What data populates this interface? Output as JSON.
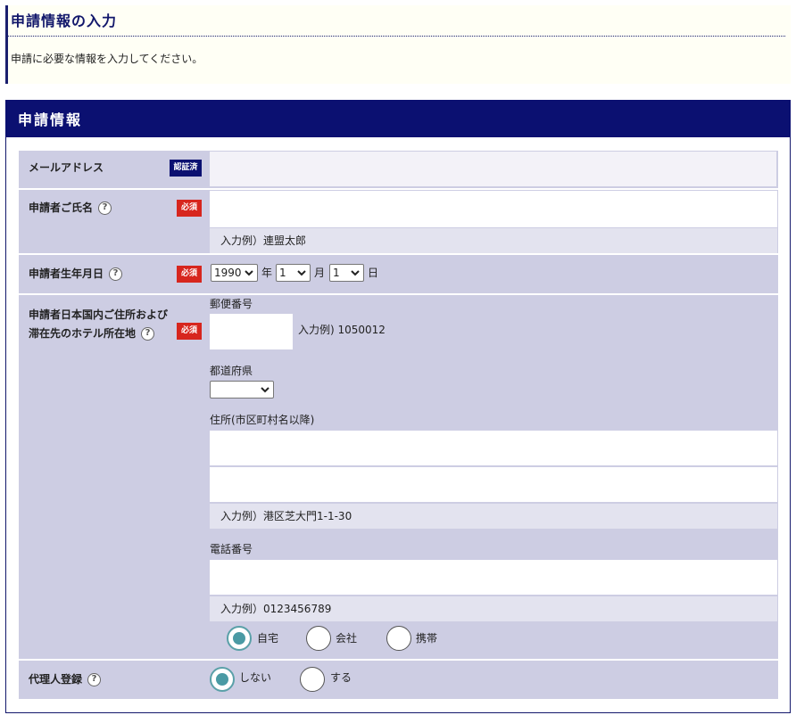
{
  "page": {
    "title": "申請情報の入力",
    "description": "申請に必要な情報を入力してください。"
  },
  "section": {
    "title": "申請情報"
  },
  "colors": {
    "navy": "#0b1071",
    "row_bg": "#cdcde3",
    "required_badge": "#d7261e",
    "radio_checked": "#4a9aa4"
  },
  "fields": {
    "email": {
      "label": "メールアドレス",
      "badge": "認証済",
      "value": ""
    },
    "name": {
      "label": "申請者ご氏名",
      "badge": "必須",
      "value": "",
      "example": "入力例）連盟太郎"
    },
    "birthdate": {
      "label": "申請者生年月日",
      "badge": "必須",
      "year": "1990",
      "year_unit": "年",
      "month": "1",
      "month_unit": "月",
      "day": "1",
      "day_unit": "日"
    },
    "address": {
      "label_line1": "申請者日本国内ご住所および",
      "label_line2": "滞在先のホテル所在地",
      "badge": "必須",
      "postal_label": "郵便番号",
      "postal_value": "",
      "postal_example": "入力例) 1050012",
      "prefecture_label": "都道府県",
      "prefecture_value": "",
      "address_label": "住所(市区町村名以降)",
      "address_line1": "",
      "address_line2": "",
      "address_example": "入力例）港区芝大門1-1-30",
      "phone_label": "電話番号",
      "phone_value": "",
      "phone_example": "入力例）0123456789",
      "phone_types": [
        {
          "label": "自宅",
          "checked": true
        },
        {
          "label": "会社",
          "checked": false
        },
        {
          "label": "携帯",
          "checked": false
        }
      ]
    },
    "agent": {
      "label": "代理人登録",
      "options": [
        {
          "label": "しない",
          "checked": true
        },
        {
          "label": "する",
          "checked": false
        }
      ]
    }
  },
  "icons": {
    "help": "?",
    "chevron": "chevron-down-icon"
  }
}
